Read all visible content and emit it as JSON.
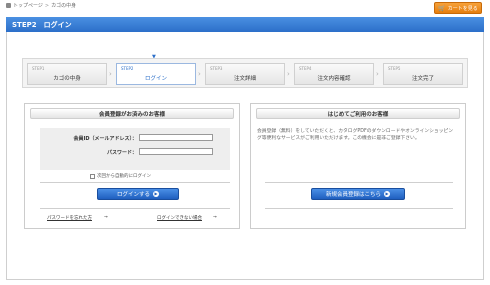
{
  "breadcrumb": {
    "home": "トップページ",
    "separator": ">",
    "current": "カゴの中身"
  },
  "cart_button": {
    "label": "カートを見る"
  },
  "step_bar": {
    "title": "STEP2　ログイン"
  },
  "steps": [
    {
      "num": "STEP1",
      "name": "カゴの中身"
    },
    {
      "num": "STEP2",
      "name": "ログイン"
    },
    {
      "num": "STEP3",
      "name": "注文詳細"
    },
    {
      "num": "STEP4",
      "name": "注文内容確認"
    },
    {
      "num": "STEP5",
      "name": "注文完了"
    }
  ],
  "member_panel": {
    "title": "会員登録がお済みのお客様",
    "id_label": "会員ID（メールアドレス）：",
    "id_value": "",
    "password_label": "パスワード：",
    "password_value": "",
    "auto_login_label": "次回から自動的にログイン",
    "login_button": "ログインする",
    "forgot_link": "パスワードを忘れた方",
    "trouble_link": "ログインできない場合"
  },
  "new_panel": {
    "title": "はじめてご利用のお客様",
    "description": "会員登録（無料）をしていただくと、カタログPDFのダウンロードやオンラインショッピング等便利なサービスがご利用いただけます。この機会に是非ご登録下さい。",
    "register_button": "新規会員登録はこちら"
  },
  "colors": {
    "accent": "#2c6fc9",
    "cart": "#f28c1c"
  }
}
